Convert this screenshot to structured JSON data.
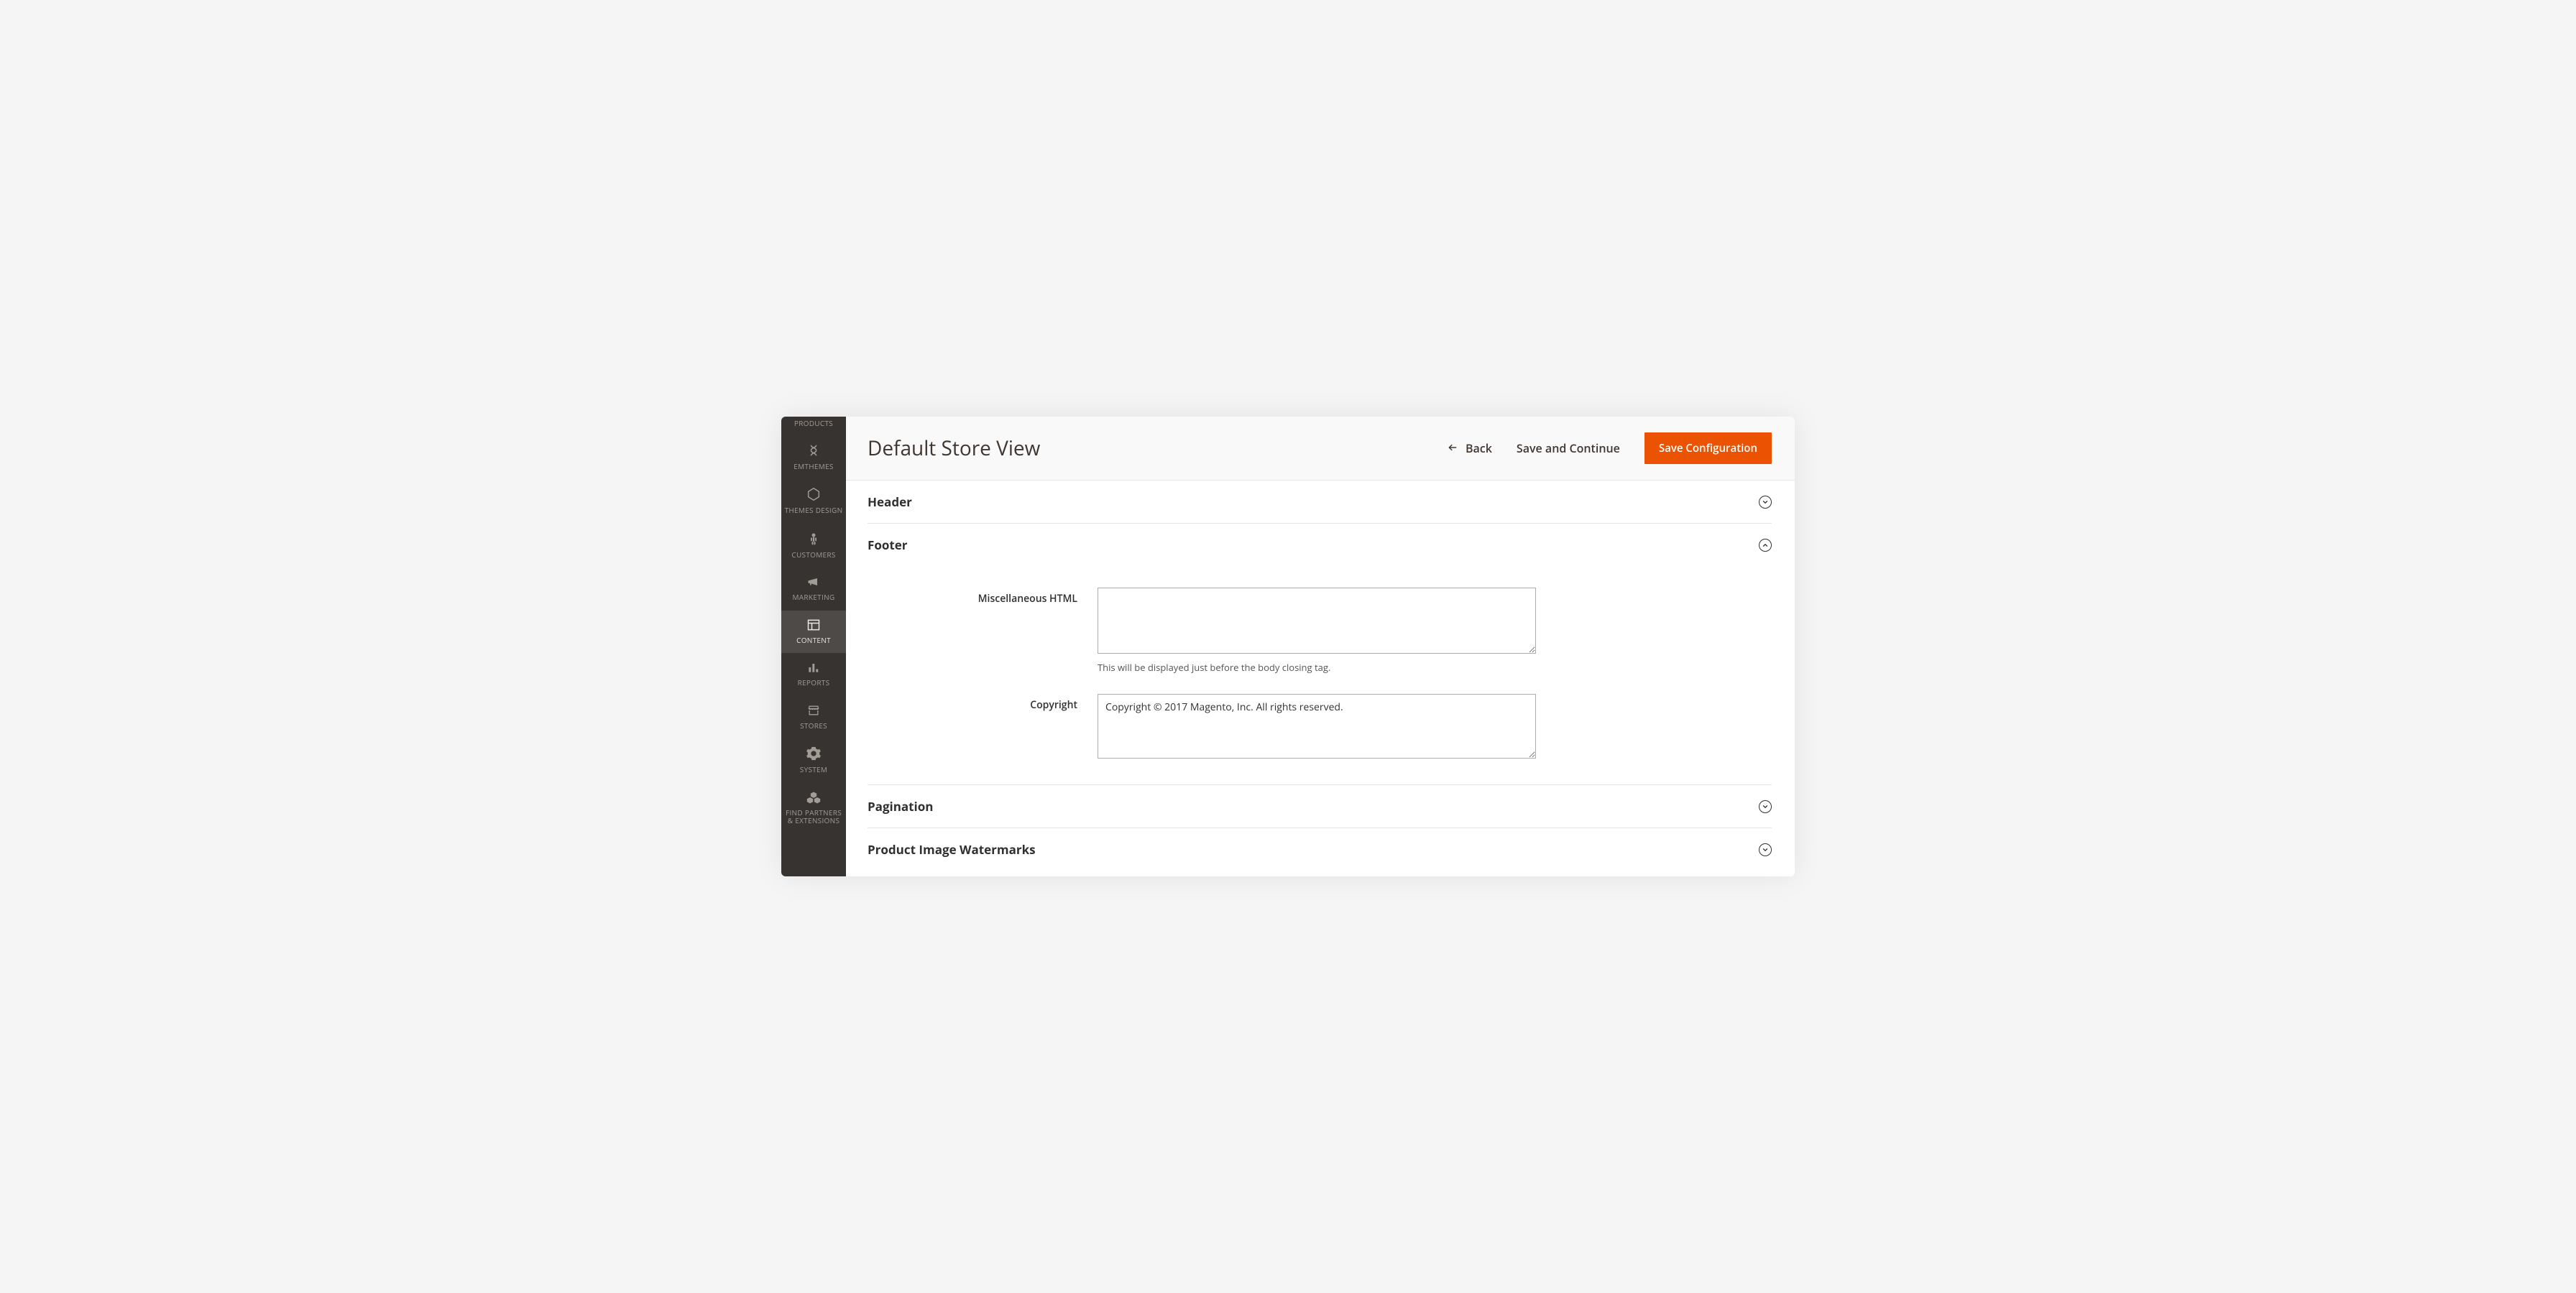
{
  "sidebar": {
    "items": [
      {
        "label": "PRODUCTS",
        "icon": "products"
      },
      {
        "label": "EMTHEMES",
        "icon": "emthemes"
      },
      {
        "label": "THEMES DESIGN",
        "icon": "hexagon"
      },
      {
        "label": "CUSTOMERS",
        "icon": "person"
      },
      {
        "label": "MARKETING",
        "icon": "megaphone"
      },
      {
        "label": "CONTENT",
        "icon": "layout",
        "active": true
      },
      {
        "label": "REPORTS",
        "icon": "bars"
      },
      {
        "label": "STORES",
        "icon": "storefront"
      },
      {
        "label": "SYSTEM",
        "icon": "gear"
      },
      {
        "label": "FIND PARTNERS & EXTENSIONS",
        "icon": "boxes"
      }
    ]
  },
  "header": {
    "title": "Default Store View",
    "back_label": "Back",
    "save_continue_label": "Save and Continue",
    "save_config_label": "Save Configuration"
  },
  "sections": {
    "header": {
      "title": "Header",
      "expanded": false
    },
    "footer": {
      "title": "Footer",
      "expanded": true,
      "misc_html": {
        "label": "Miscellaneous HTML",
        "value": "",
        "note": "This will be displayed just before the body closing tag."
      },
      "copyright": {
        "label": "Copyright",
        "value": "Copyright © 2017 Magento, Inc. All rights reserved."
      }
    },
    "pagination": {
      "title": "Pagination",
      "expanded": false
    },
    "watermarks": {
      "title": "Product Image Watermarks",
      "expanded": false
    }
  }
}
